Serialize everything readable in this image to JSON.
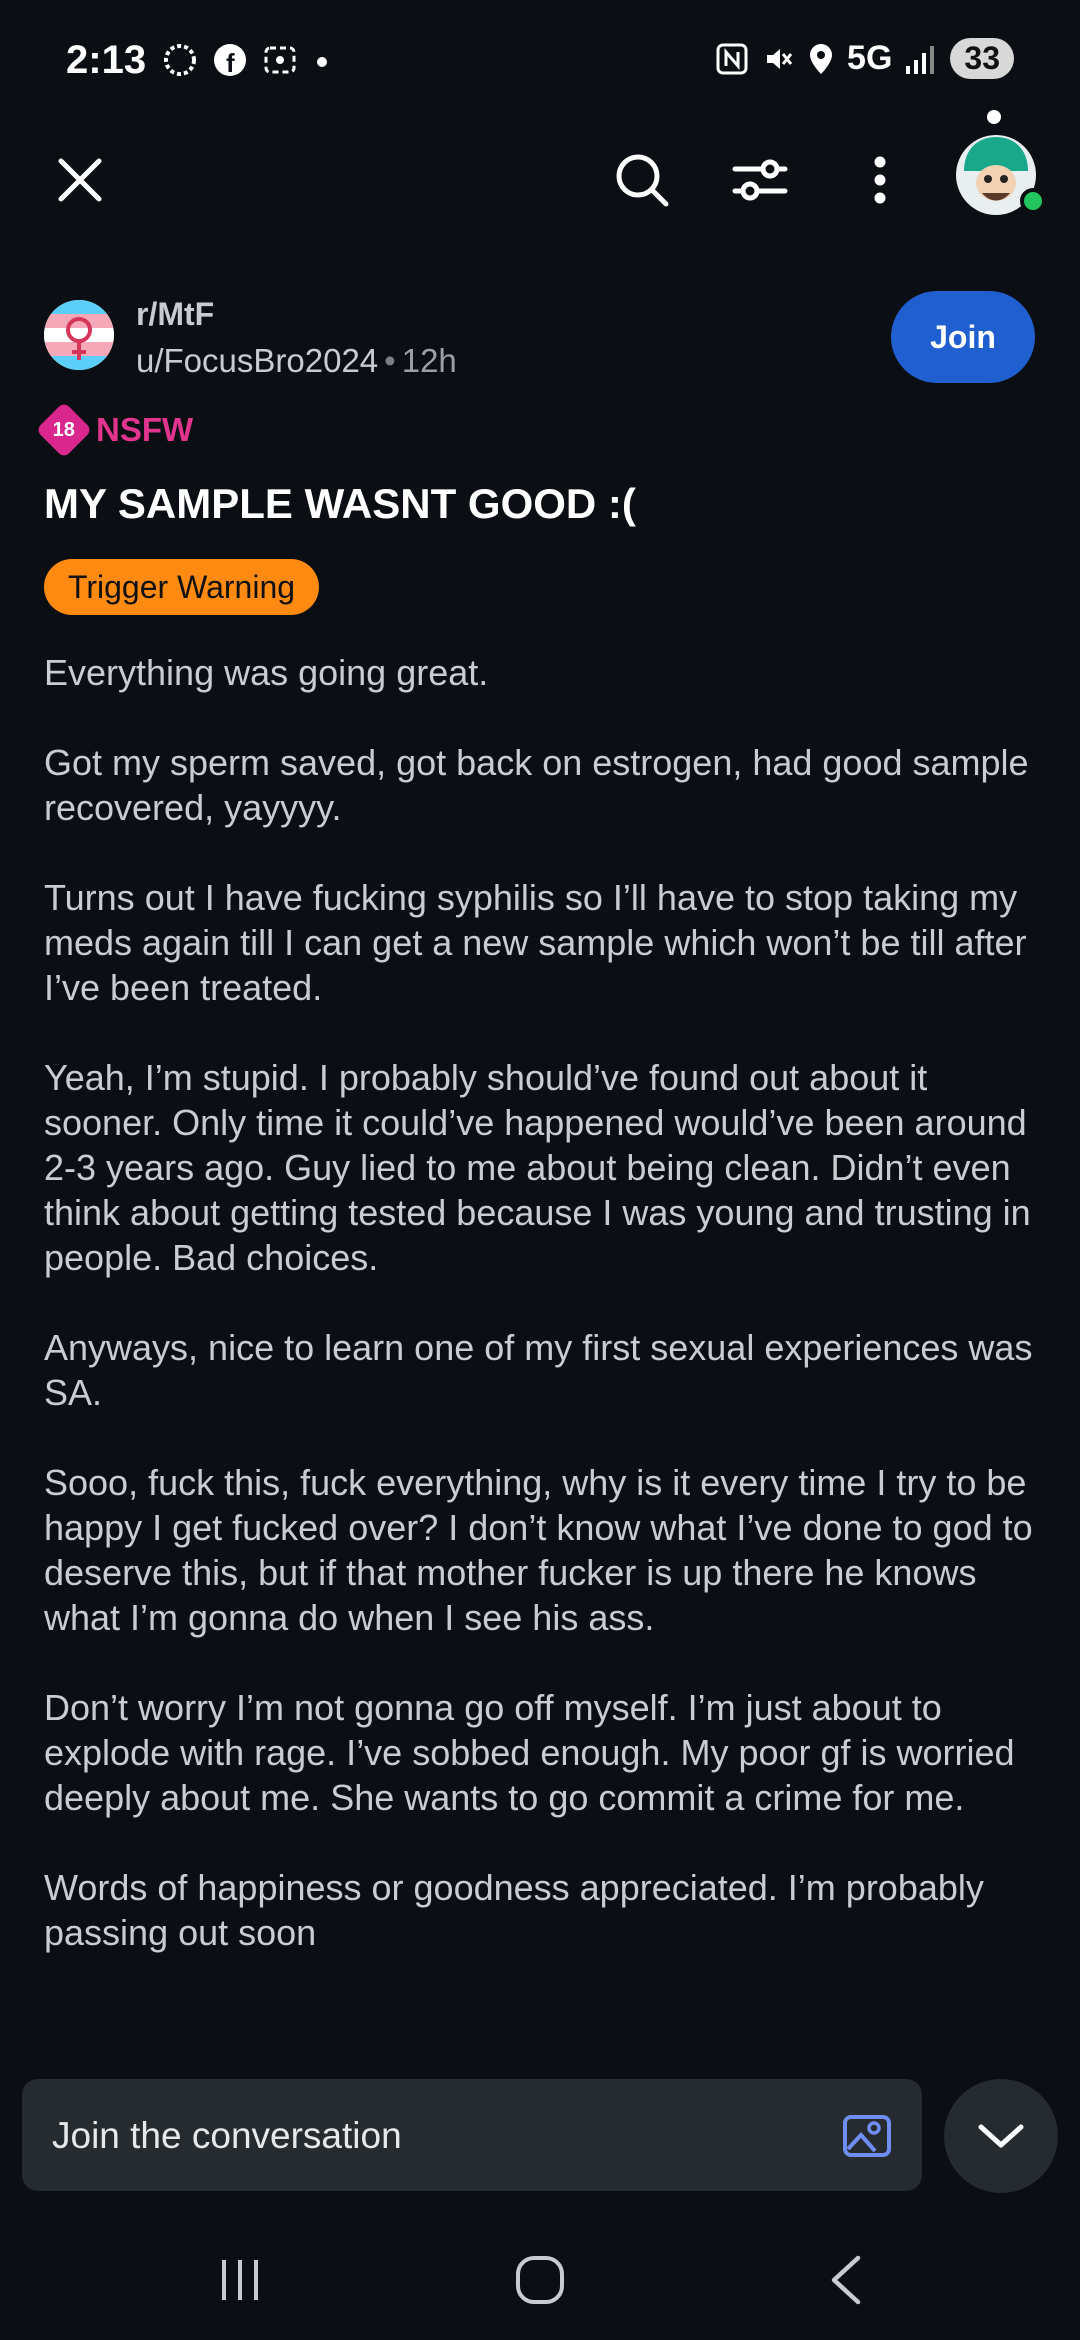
{
  "status_bar": {
    "time": "2:13",
    "network": "5G",
    "battery": "33"
  },
  "post": {
    "subreddit": "r/MtF",
    "author": "u/FocusBro2024",
    "separator": "•",
    "age": "12h",
    "join_label": "Join",
    "nsfw_badge": "18",
    "nsfw_label": "NSFW",
    "title": "MY SAMPLE WASNT GOOD :(",
    "flair": "Trigger Warning",
    "paragraphs": [
      "Everything was going great.",
      "Got my sperm saved, got back on estrogen, had good sample recovered, yayyyy.",
      "Turns out I have fucking syphilis so I’ll have to stop taking my meds again till I can get a new sample which won’t be till after I’ve been treated.",
      "Yeah, I’m stupid. I probably should’ve found out about it sooner. Only time it could’ve happened would’ve been around 2-3 years ago. Guy lied to me about being clean. Didn’t even think about getting tested because I was young and trusting in people. Bad choices.",
      "Anyways, nice to learn one of my first sexual experiences was SA.",
      "Sooo, fuck this, fuck everything, why is it every time I try to be happy I get fucked over? I don’t know what I’ve done to god to deserve this, but if that mother fucker is up there he knows what I’m gonna do when I see his ass.",
      "Don’t worry I’m not gonna go off myself. I’m just about to explode with rage. I’ve sobbed enough. My poor gf is worried deeply about me. She wants to go commit a crime for me.",
      "Words of happiness or goodness appreciated. I’m probably passing out soon"
    ]
  },
  "composer": {
    "placeholder": "Join the conversation"
  },
  "colors": {
    "background": "#0b0f13",
    "join_button": "#1f5fd0",
    "nsfw": "#e0348f",
    "flair": "#ff8a12",
    "composer": "#262b30"
  },
  "icons": [
    "close-icon",
    "search-icon",
    "filter-icon",
    "more-icon",
    "avatar",
    "image-icon",
    "chevron-down-icon",
    "recents-icon",
    "home-icon",
    "back-icon"
  ]
}
